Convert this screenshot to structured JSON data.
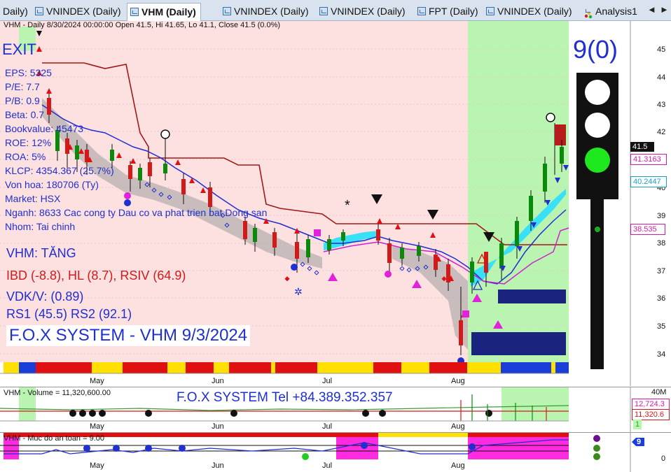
{
  "tabs": [
    {
      "label": "Daily)",
      "active": false
    },
    {
      "label": "VNINDEX (Daily)",
      "active": false
    },
    {
      "label": "VHM (Daily)",
      "active": true
    },
    {
      "label": "VNINDEX (Daily)",
      "active": false
    },
    {
      "label": "VNINDEX (Daily)",
      "active": false
    },
    {
      "label": "FPT (Daily)",
      "active": false
    },
    {
      "label": "VNINDEX (Daily)",
      "active": false
    },
    {
      "label": "Analysis1",
      "active": false
    }
  ],
  "nav": {
    "prev": "◄",
    "next": "►"
  },
  "main": {
    "header": "VHM - Daily 8/30/2024 00:00:00 Open 41.5, Hi 41.65, Lo 41.1, Close 41.5 (0.0%)",
    "exit_label": "EXIT",
    "fundamentals": [
      "EPS: 5325",
      "P/E: 7.7",
      "P/B: 0.9",
      "Beta: 0.7",
      "Bookvalue: 45473",
      "ROE: 12%",
      "ROA: 5%",
      "KLCP: 4354.367 (25.7%)",
      "Von hoa: 180706 (Ty)",
      "Market: HSX",
      "Nganh: 8633 Cac cong ty Dau co va phat trien bat Dong san",
      "Nhom: Tai chinh"
    ],
    "trend": "VHM: TĂNG",
    "ibd": "IBD (-8.8), HL (8.7), RSIV (64.9)",
    "vdk": "VDK/V:  (0.89)",
    "rs": "RS1 (45.5) RS2 (92.1)",
    "system_title": "F.O.X SYSTEM - VHM 9/3/2024",
    "signal_count": "9(0)",
    "y_ticks": [
      "45",
      "44",
      "43",
      "42",
      "41.5",
      "41.3163",
      "40.2447",
      "40",
      "39",
      "38.535",
      "38",
      "37",
      "36",
      "35",
      "34"
    ],
    "price_badges": [
      {
        "label": "41.5",
        "color": "#111111"
      },
      {
        "label": "41.3163",
        "color": "#d21aa8"
      },
      {
        "label": "40.2447",
        "color": "#1aa0c8"
      },
      {
        "label": "38.535",
        "color": "#d21aa8"
      }
    ],
    "months": [
      "May",
      "Jun",
      "Jul",
      "Aug"
    ],
    "marker_star": "*",
    "traffic_light": {
      "top": "#ffffff",
      "middle": "#ffffff",
      "bottom": "#1ee81e",
      "small_dot": "#22aa22"
    }
  },
  "volume": {
    "header": "VHM - Volume = 11,320,600.00",
    "brand": "F.O.X SYSTEM Tel +84.389.352.357",
    "ticks": [
      "40M"
    ],
    "badges": [
      {
        "label": "12,724.3",
        "color": "#d21aa8"
      },
      {
        "label": "11,320.6",
        "color": "#d21a1a"
      },
      {
        "label": "1",
        "color": "#22aa22"
      }
    ],
    "months": [
      "May",
      "Jun",
      "Jul",
      "Aug"
    ]
  },
  "safety": {
    "header": "VHM - Muc do an toan = 9.00",
    "ticks": [
      "0"
    ],
    "badge": "9",
    "months": [
      "May",
      "Jun",
      "Jul",
      "Aug"
    ],
    "indicator_dots": [
      "#6a0f8e",
      "#3c8a1c",
      "#3c8a1c"
    ]
  },
  "colors": {
    "bg_pink": "#fde0e0",
    "bg_green": "#b9f5b0",
    "up_candle": "#0a8a0a",
    "down_candle": "#d21a1a",
    "ma_red": "#a11818",
    "ma_blue": "#1f2fd0",
    "cloud_cyan": "#38e0f8",
    "band_magenta": "#cc22cc",
    "box_navy": "#1a237e"
  }
}
